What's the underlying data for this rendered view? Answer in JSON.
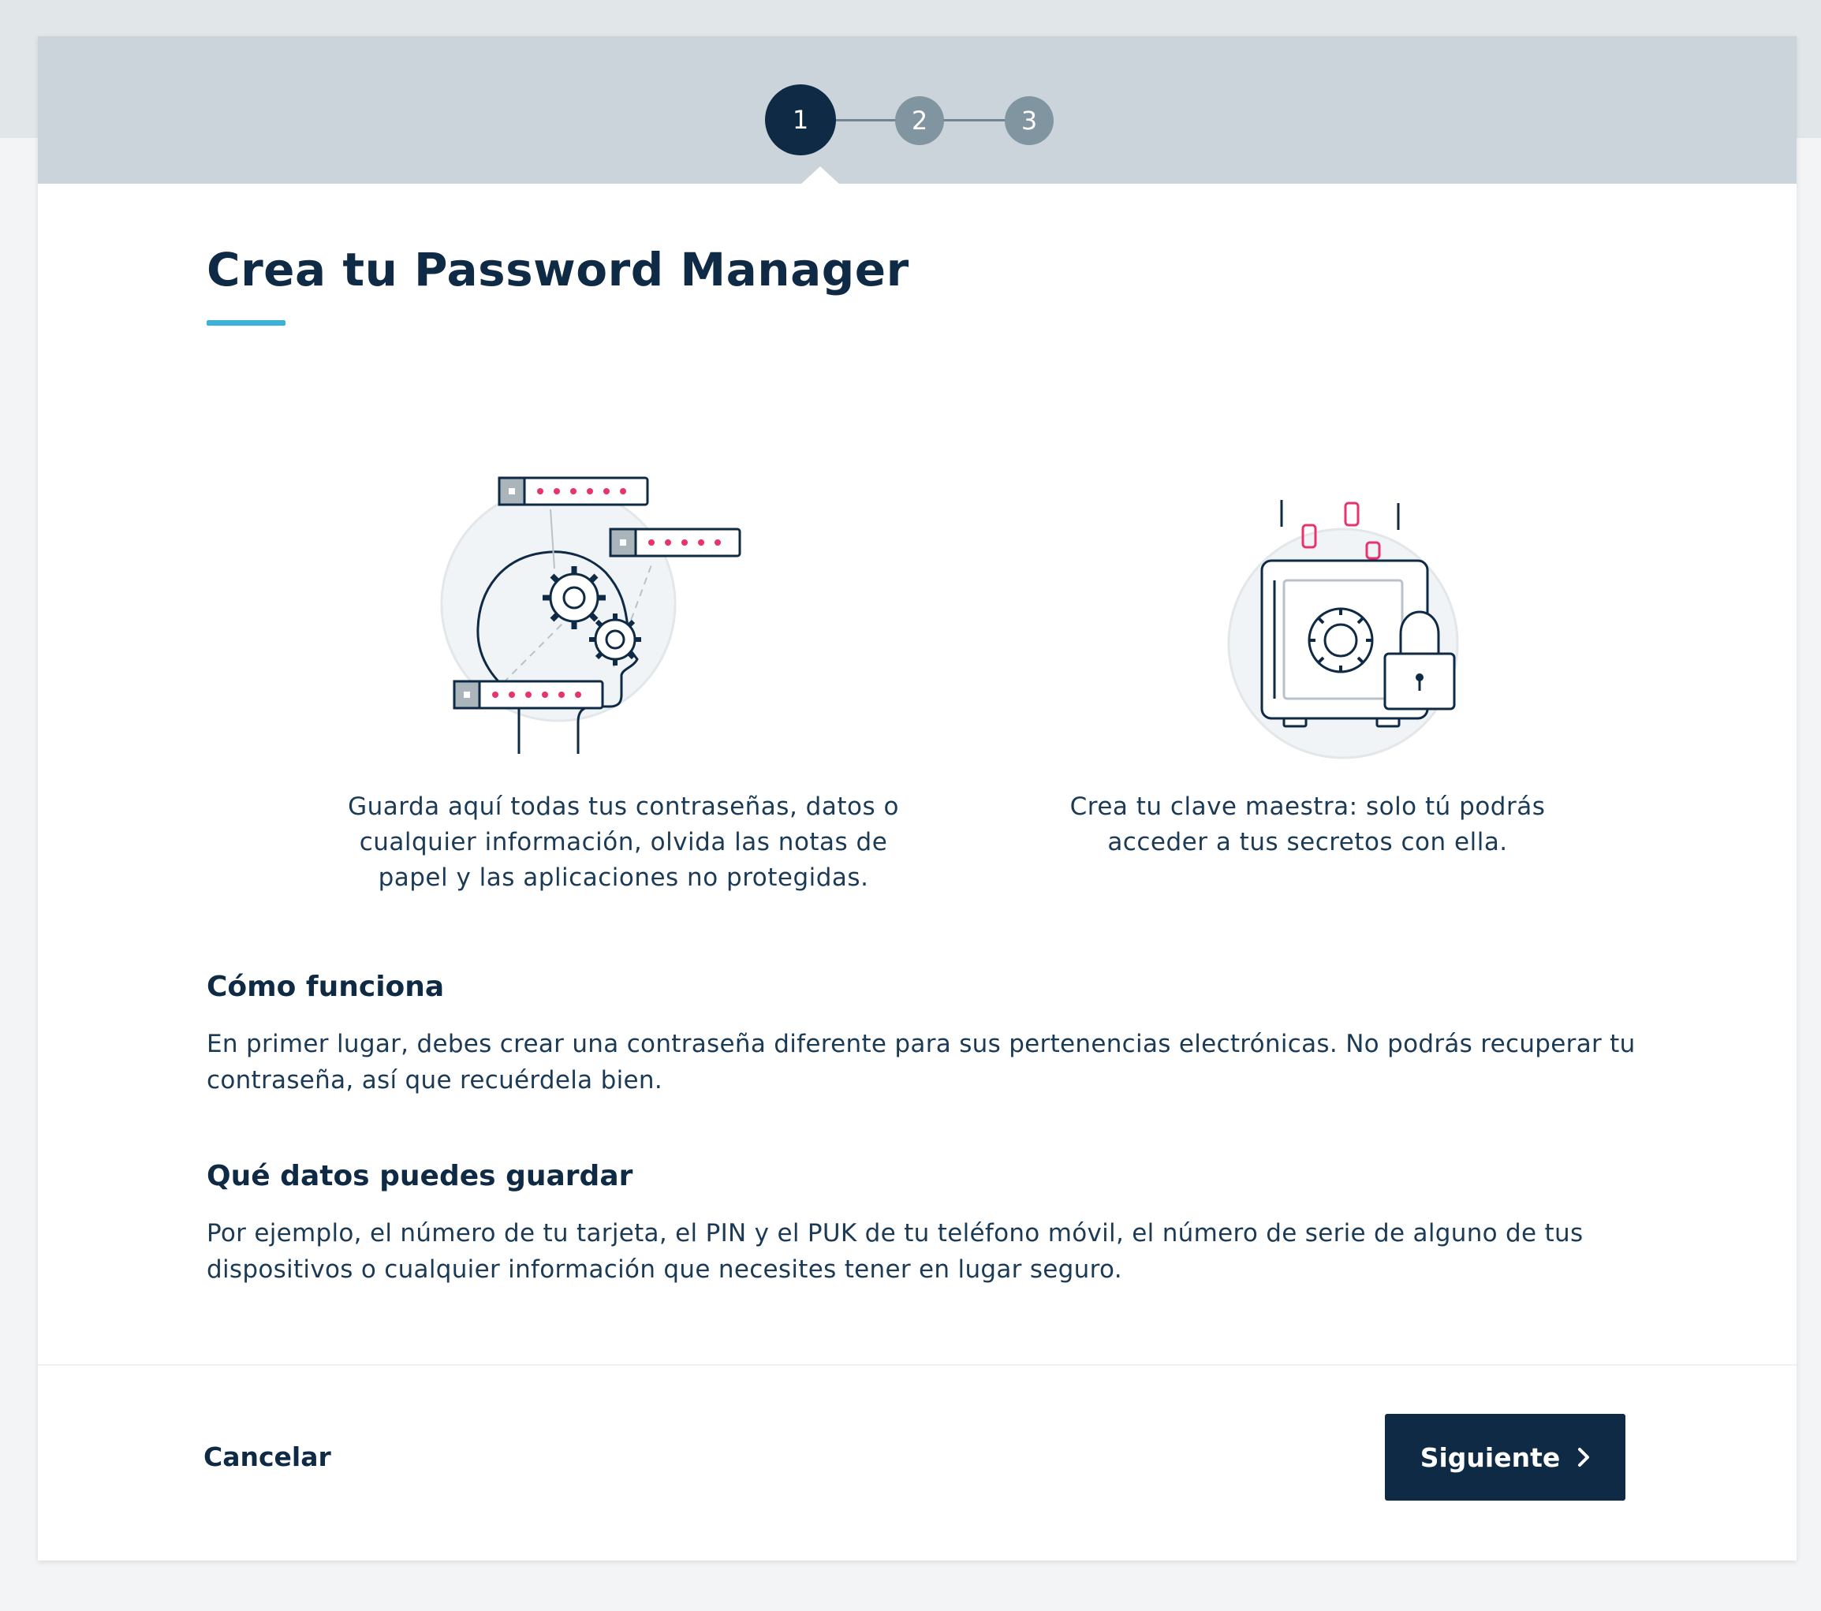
{
  "stepper": {
    "steps": [
      {
        "label": "1",
        "state": "active"
      },
      {
        "label": "2",
        "state": "inactive"
      },
      {
        "label": "3",
        "state": "inactive"
      }
    ]
  },
  "page": {
    "title": "Crea tu Password Manager"
  },
  "features": [
    {
      "icon": "head-gears-passwords-icon",
      "text": "Guarda aquí todas tus contraseñas, datos o cualquier información, olvida las notas de papel y las aplicaciones no protegidas."
    },
    {
      "icon": "safe-lock-icon",
      "text": "Crea tu clave maestra: solo tú podrás acceder a tus secretos con ella."
    }
  ],
  "sections": [
    {
      "heading": "Cómo funciona",
      "body": "En primer lugar, debes crear una contraseña diferente para sus pertenencias electrónicas. No podrás recuperar tu contraseña, así que recuérdela bien."
    },
    {
      "heading": "Qué datos puedes guardar",
      "body": "Por ejemplo, el número de tu tarjeta, el PIN y el PUK de tu teléfono móvil, el número de serie de alguno de tus dispositivos o cualquier información que necesites tener en lugar seguro."
    }
  ],
  "footer": {
    "cancel_label": "Cancelar",
    "next_label": "Siguiente"
  },
  "colors": {
    "primary_navy": "#0f2a45",
    "accent_cyan": "#3db2d8",
    "accent_pink": "#e8336b",
    "header_gray": "#cbd4da",
    "step_inactive": "#8195a0"
  }
}
